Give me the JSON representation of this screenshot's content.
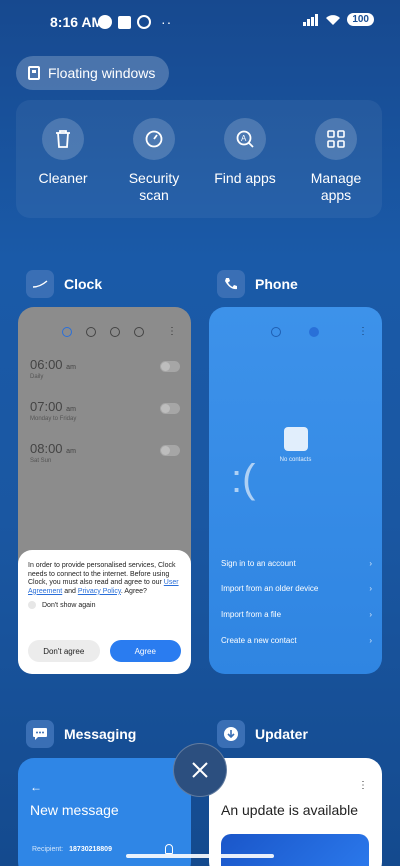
{
  "status_bar": {
    "time": "8:16 AM",
    "battery": "100",
    "more": "··"
  },
  "floating_windows": {
    "label": "Floating windows",
    "icon": "floating-window-icon"
  },
  "tools": [
    {
      "label": "Cleaner",
      "icon": "trash-icon"
    },
    {
      "label": "Security scan",
      "icon": "shield-check-icon"
    },
    {
      "label": "Find apps",
      "icon": "search-app-icon"
    },
    {
      "label": "Manage apps",
      "icon": "grid-icon"
    }
  ],
  "apps": {
    "clock": {
      "name": "Clock",
      "icon_color": "#3a6fb5",
      "alarms": [
        {
          "time": "06:00",
          "suffix": "am",
          "sub": "Daily"
        },
        {
          "time": "07:00",
          "suffix": "am",
          "sub": "Monday to Friday"
        },
        {
          "time": "08:00",
          "suffix": "am",
          "sub": "Sat Sun"
        }
      ],
      "dialog": {
        "text_1": "In order to provide personalised services, Clock needs to connect to the internet. Before using Clock, you must also read and agree to our ",
        "link_1": "User Agreement",
        "text_2": " and ",
        "link_2": "Privacy Policy",
        "text_3": ". Agree?",
        "checkbox_label": "Don't show again",
        "cancel": "Don't agree",
        "confirm": "Agree"
      }
    },
    "phone": {
      "name": "Phone",
      "icon_color": "#3a6fb5",
      "no_contacts": "No contacts",
      "options": [
        "Sign in to an account",
        "Import from an older device",
        "Import from a file",
        "Create a new contact"
      ]
    },
    "messaging": {
      "name": "Messaging",
      "title": "New message",
      "recipient_label": "Recipient:",
      "recipient_value": "18730218809"
    },
    "updater": {
      "name": "Updater",
      "title": "An update is available"
    }
  },
  "colors": {
    "accent": "#2a7cf0",
    "background": "#1a5aa8"
  }
}
